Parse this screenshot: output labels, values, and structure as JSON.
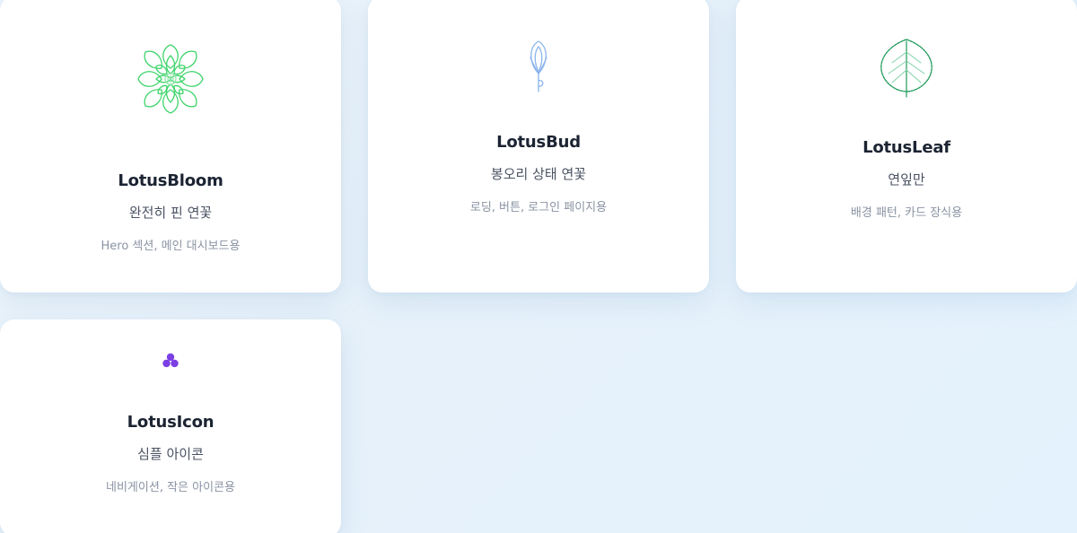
{
  "cards": [
    {
      "title": "LotusBloom",
      "subtitle": "완전히 핀 연꽃",
      "description": "Hero 섹션, 메인 대시보드용",
      "icon": "lotus-bloom-icon",
      "color": "#3dd46a"
    },
    {
      "title": "LotusBud",
      "subtitle": "봉오리 상태 연꽃",
      "description": "로딩, 버튼, 로그인 페이지용",
      "icon": "lotus-bud-icon",
      "color": "#8ab4ec"
    },
    {
      "title": "LotusLeaf",
      "subtitle": "연잎만",
      "description": "배경 패턴, 카드 장식용",
      "icon": "lotus-leaf-icon",
      "color": "#1f9a5a"
    },
    {
      "title": "LotusIcon",
      "subtitle": "심플 아이콘",
      "description": "네비게이션, 작은 아이콘용",
      "icon": "lotus-icon",
      "color": "#7b3fe4"
    }
  ]
}
